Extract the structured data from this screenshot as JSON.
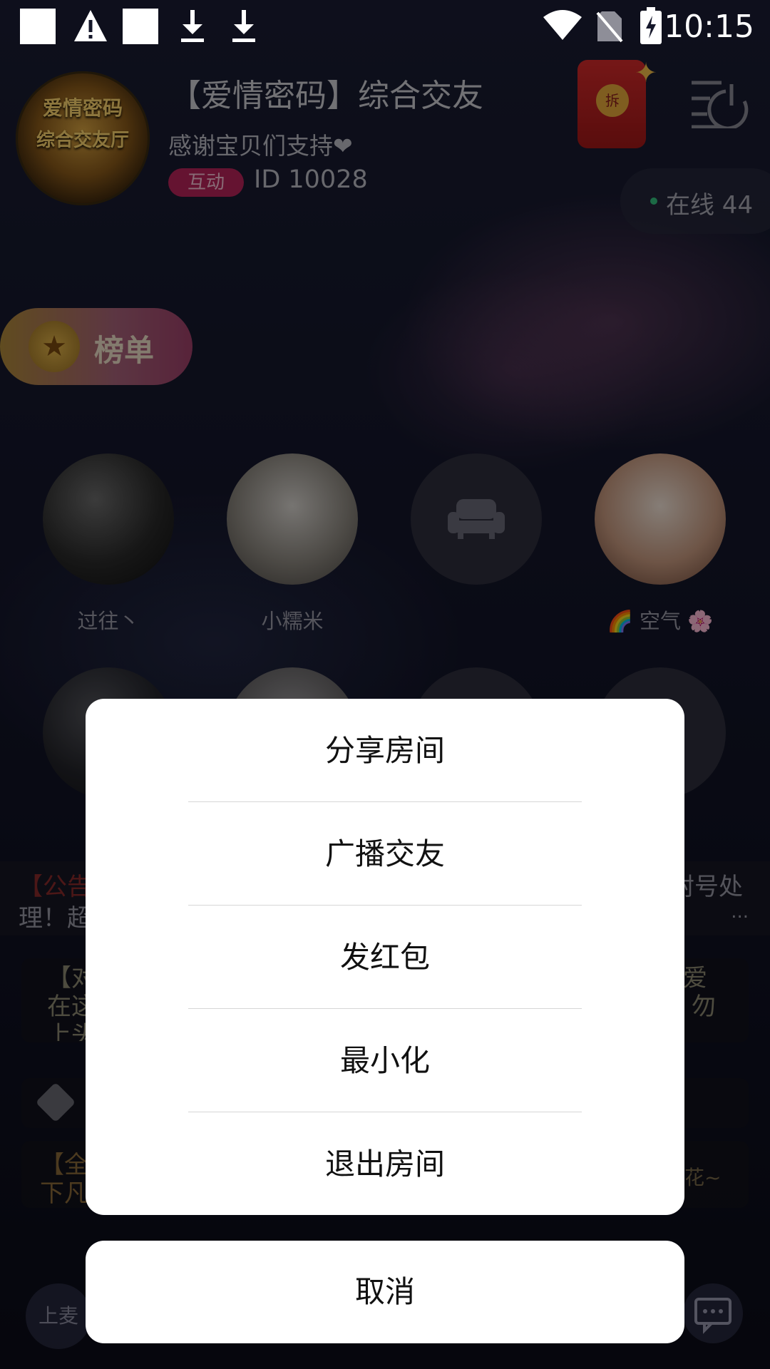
{
  "status_bar": {
    "time": "10:15",
    "icons": [
      "notification-square-icon",
      "warning-icon",
      "notification-square-icon",
      "download-icon",
      "download-icon",
      "wifi-icon",
      "no-sim-icon",
      "battery-charging-icon"
    ]
  },
  "room": {
    "title": "【爱情密码】综合交友",
    "subtitle": "感谢宝贝们支持❤",
    "tag": "互动",
    "id_text": "ID 10028",
    "online_text": "在线 44",
    "logo_text_1": "爱情密码",
    "logo_text_2": "综合交友厅",
    "red_packet_label": "拆"
  },
  "rank_button": {
    "label": "榜单"
  },
  "seats": [
    {
      "name": "过往丶"
    },
    {
      "name": "小糯米"
    },
    {
      "name": ""
    },
    {
      "name": "🌈 空气 🌸"
    }
  ],
  "background_text": {
    "notice_left_1": "【公告",
    "notice_left_2": "理！超",
    "notice_right_1": "封号处",
    "notice_right_2": "...",
    "card1_left": [
      "【对",
      "在这",
      "上头"
    ],
    "card1_right": [
      "爱",
      "勿"
    ],
    "card3_left": [
      "【全",
      "下凡"
    ],
    "card3_right": "花~",
    "bottom_left_label": "上麦"
  },
  "action_sheet": {
    "items": [
      "分享房间",
      "广播交友",
      "发红包",
      "最小化",
      "退出房间"
    ],
    "cancel": "取消"
  },
  "colors": {
    "sheet_bg": "#ffffff",
    "tag_bg": "#b8245a",
    "online_dot": "#34c27f"
  }
}
